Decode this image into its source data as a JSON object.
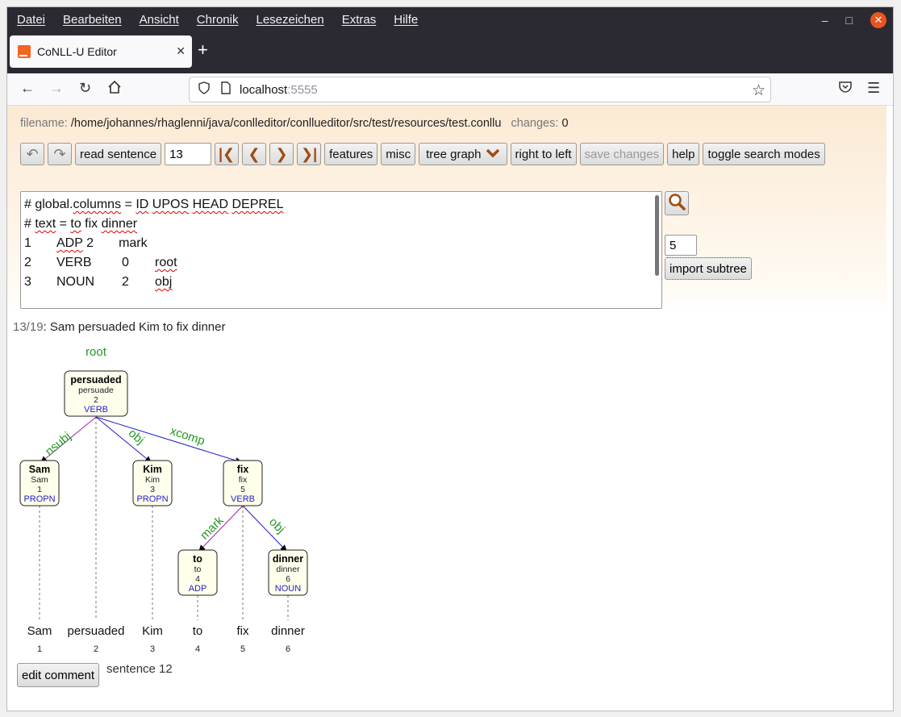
{
  "browser": {
    "menu": [
      "Datei",
      "Bearbeiten",
      "Ansicht",
      "Chronik",
      "Lesezeichen",
      "Extras",
      "Hilfe"
    ],
    "tab_title": "CoNLL-U Editor",
    "url_host": "localhost",
    "url_port": ":5555"
  },
  "file": {
    "label": "filename:",
    "path": "/home/johannes/rhaglenni/java/conlleditor/conllueditor/src/test/resources/test.conllu",
    "changes_label": "changes:",
    "changes_value": "0"
  },
  "toolbar": {
    "read_sentence": "read sentence",
    "sentence_number": "13",
    "features": "features",
    "misc": "misc",
    "tree_graph": "tree graph",
    "right_to_left": "right to left",
    "save_changes": "save changes",
    "help": "help",
    "toggle_search_modes": "toggle search modes"
  },
  "editor": {
    "line1_prefix": "# global.",
    "line1_word": "columns",
    "line1_mid": " = ",
    "line1_id": "ID",
    "line1_upos": "UPOS",
    "line1_head": "HEAD",
    "line1_deprel": "DEPREL",
    "line2_prefix": "# ",
    "line2_text": "text",
    "line2_mid": " = ",
    "line2_to": "to",
    "line2_fix": " fix ",
    "line2_dinner": "dinner",
    "rows": [
      {
        "id": "1",
        "upos": "ADP",
        "head": "2",
        "deprel": "mark"
      },
      {
        "id": "2",
        "upos": "VERB",
        "head": "0",
        "deprel": "root"
      },
      {
        "id": "3",
        "upos": "NOUN",
        "head": "2",
        "deprel": "obj"
      }
    ]
  },
  "subtree": {
    "value": "5",
    "import_label": "import subtree"
  },
  "sentence": {
    "counter": "13/19",
    "text": ": Sam persuaded Kim to fix dinner"
  },
  "tree": {
    "root_label": "root",
    "nodes": [
      {
        "form": "persuaded",
        "lemma": "persuade",
        "id": "2",
        "upos": "VERB"
      },
      {
        "form": "Sam",
        "lemma": "Sam",
        "id": "1",
        "upos": "PROPN"
      },
      {
        "form": "Kim",
        "lemma": "Kim",
        "id": "3",
        "upos": "PROPN"
      },
      {
        "form": "fix",
        "lemma": "fix",
        "id": "5",
        "upos": "VERB"
      },
      {
        "form": "to",
        "lemma": "to",
        "id": "4",
        "upos": "ADP"
      },
      {
        "form": "dinner",
        "lemma": "dinner",
        "id": "6",
        "upos": "NOUN"
      }
    ],
    "deprels": [
      "nsubj",
      "obj",
      "xcomp",
      "mark",
      "obj"
    ],
    "words": [
      {
        "form": "Sam",
        "idx": "1"
      },
      {
        "form": "persuaded",
        "idx": "2"
      },
      {
        "form": "Kim",
        "idx": "3"
      },
      {
        "form": "to",
        "idx": "4"
      },
      {
        "form": "fix",
        "idx": "5"
      },
      {
        "form": "dinner",
        "idx": "6"
      }
    ]
  },
  "footer": {
    "edit_comment": "edit comment",
    "sentence_prev": "sentence 12"
  }
}
